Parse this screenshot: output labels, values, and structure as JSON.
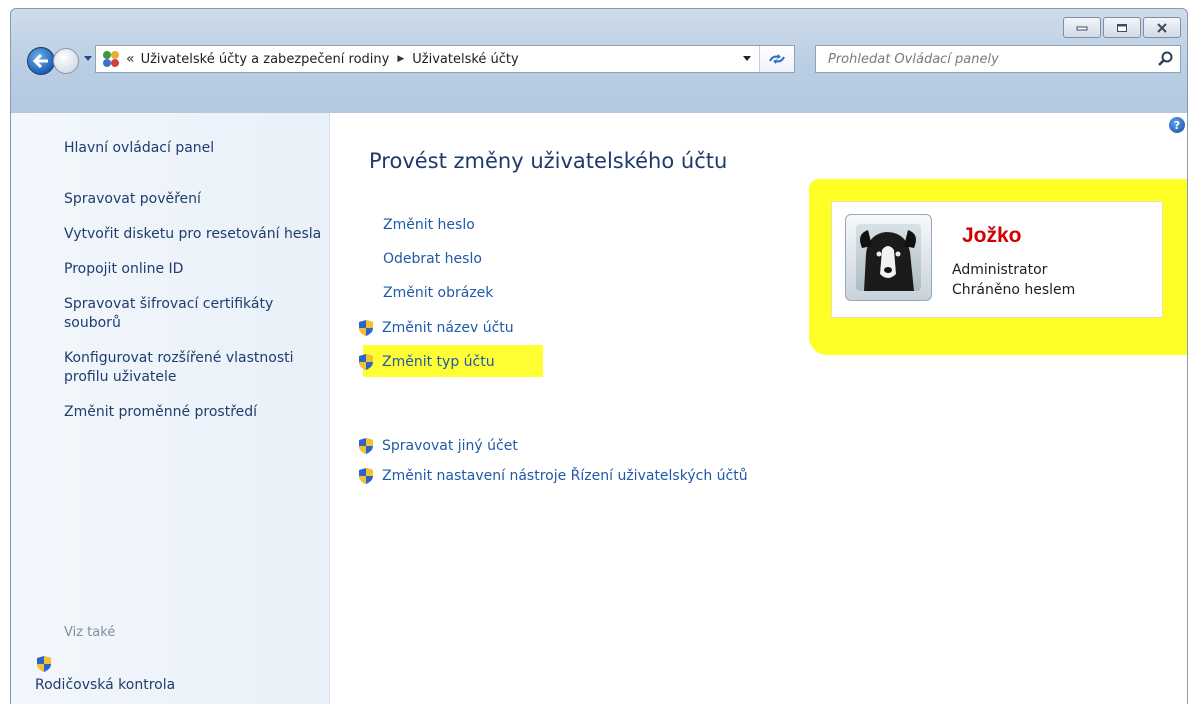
{
  "window": {
    "caption_buttons": [
      "minimize-icon",
      "maximize-icon",
      "close-icon"
    ]
  },
  "navbar": {
    "breadcrumb_overflow": "«",
    "breadcrumbs": [
      {
        "label": "Uživatelské účty a zabezpečení rodiny"
      },
      {
        "label": "Uživatelské účty"
      }
    ],
    "search_placeholder": "Prohledat Ovládací panely"
  },
  "sidebar": {
    "home": "Hlavní ovládací panel",
    "tasks": [
      "Spravovat pověření",
      "Vytvořit disketu pro resetování hesla",
      "Propojit online ID",
      "Spravovat šifrovací certifikáty souborů",
      "Konfigurovat rozšířené vlastnosti profilu uživatele",
      "Změnit proměnné prostředí"
    ],
    "see_also_label": "Viz také",
    "see_also_item": "Rodičovská kontrola"
  },
  "main": {
    "title": "Provést změny uživatelského účtu",
    "actions": [
      {
        "label": "Změnit heslo",
        "shield": false
      },
      {
        "label": "Odebrat heslo",
        "shield": false
      },
      {
        "label": "Změnit obrázek",
        "shield": false
      },
      {
        "label": "Změnit název účtu",
        "shield": true
      },
      {
        "label": "Změnit typ účtu",
        "shield": true
      }
    ],
    "other_actions": [
      {
        "label": "Spravovat jiný účet",
        "shield": true
      },
      {
        "label": "Změnit nastavení nástroje Řízení uživatelských účtů",
        "shield": true
      }
    ]
  },
  "user": {
    "name": "Jožko",
    "role": "Administrator",
    "status": "Chráněno heslem"
  },
  "colors": {
    "highlight": "#ffff26",
    "link": "#1f5aa8",
    "username": "#d10000"
  }
}
